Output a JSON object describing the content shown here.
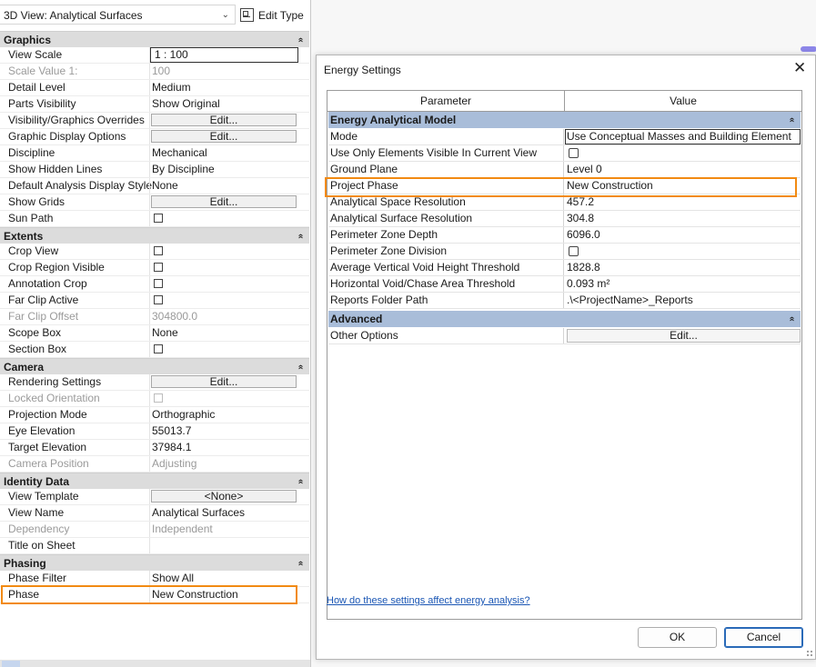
{
  "properties": {
    "type_selector": "3D View: Analytical Surfaces",
    "edit_type_label": "Edit Type",
    "sections": [
      {
        "title": "Graphics",
        "rows": [
          {
            "label": "View Scale",
            "value": "1 : 100",
            "kind": "input"
          },
          {
            "label": "Scale Value    1:",
            "value": "100",
            "kind": "text",
            "disabled": true
          },
          {
            "label": "Detail Level",
            "value": "Medium",
            "kind": "text"
          },
          {
            "label": "Parts Visibility",
            "value": "Show Original",
            "kind": "text"
          },
          {
            "label": "Visibility/Graphics Overrides",
            "value": "Edit...",
            "kind": "button"
          },
          {
            "label": "Graphic Display Options",
            "value": "Edit...",
            "kind": "button"
          },
          {
            "label": "Discipline",
            "value": "Mechanical",
            "kind": "text"
          },
          {
            "label": "Show Hidden Lines",
            "value": "By Discipline",
            "kind": "text"
          },
          {
            "label": "Default Analysis Display Style",
            "value": "None",
            "kind": "text"
          },
          {
            "label": "Show Grids",
            "value": "Edit...",
            "kind": "button"
          },
          {
            "label": "Sun Path",
            "value": "",
            "kind": "checkbox"
          }
        ]
      },
      {
        "title": "Extents",
        "rows": [
          {
            "label": "Crop View",
            "value": "",
            "kind": "checkbox"
          },
          {
            "label": "Crop Region Visible",
            "value": "",
            "kind": "checkbox"
          },
          {
            "label": "Annotation Crop",
            "value": "",
            "kind": "checkbox"
          },
          {
            "label": "Far Clip Active",
            "value": "",
            "kind": "checkbox"
          },
          {
            "label": "Far Clip Offset",
            "value": "304800.0",
            "kind": "text",
            "disabled": true
          },
          {
            "label": "Scope Box",
            "value": "None",
            "kind": "text"
          },
          {
            "label": "Section Box",
            "value": "",
            "kind": "checkbox"
          }
        ]
      },
      {
        "title": "Camera",
        "rows": [
          {
            "label": "Rendering Settings",
            "value": "Edit...",
            "kind": "button"
          },
          {
            "label": "Locked Orientation",
            "value": "",
            "kind": "checkbox",
            "disabled": true
          },
          {
            "label": "Projection Mode",
            "value": "Orthographic",
            "kind": "text"
          },
          {
            "label": "Eye Elevation",
            "value": "55013.7",
            "kind": "text"
          },
          {
            "label": "Target Elevation",
            "value": "37984.1",
            "kind": "text"
          },
          {
            "label": "Camera Position",
            "value": "Adjusting",
            "kind": "text",
            "disabled": true
          }
        ]
      },
      {
        "title": "Identity Data",
        "rows": [
          {
            "label": "View Template",
            "value": "<None>",
            "kind": "button"
          },
          {
            "label": "View Name",
            "value": "Analytical Surfaces",
            "kind": "text"
          },
          {
            "label": "Dependency",
            "value": "Independent",
            "kind": "text",
            "disabled": true
          },
          {
            "label": "Title on Sheet",
            "value": "",
            "kind": "text"
          }
        ]
      },
      {
        "title": "Phasing",
        "rows": [
          {
            "label": "Phase Filter",
            "value": "Show All",
            "kind": "text"
          },
          {
            "label": "Phase",
            "value": "New Construction",
            "kind": "text"
          }
        ]
      }
    ]
  },
  "dialog": {
    "title": "Energy Settings",
    "close_glyph": "✕",
    "columns": {
      "parameter": "Parameter",
      "value": "Value"
    },
    "sections": [
      {
        "title": "Energy Analytical Model",
        "rows": [
          {
            "label": "Mode",
            "value": "Use Conceptual Masses and Building Element",
            "kind": "dropdown"
          },
          {
            "label": "Use Only Elements Visible In Current View",
            "value": "",
            "kind": "checkbox"
          },
          {
            "label": "Ground Plane",
            "value": "Level 0",
            "kind": "text"
          },
          {
            "label": "Project Phase",
            "value": "New Construction",
            "kind": "text"
          },
          {
            "label": "Analytical Space Resolution",
            "value": "457.2",
            "kind": "text"
          },
          {
            "label": "Analytical Surface Resolution",
            "value": "304.8",
            "kind": "text"
          },
          {
            "label": "Perimeter Zone Depth",
            "value": "6096.0",
            "kind": "text"
          },
          {
            "label": "Perimeter Zone Division",
            "value": "",
            "kind": "checkbox"
          },
          {
            "label": "Average Vertical Void Height Threshold",
            "value": "1828.8",
            "kind": "text"
          },
          {
            "label": "Horizontal Void/Chase Area Threshold",
            "value": "0.093 m²",
            "kind": "text"
          },
          {
            "label": "Reports Folder Path",
            "value": ".\\<ProjectName>_Reports",
            "kind": "text"
          }
        ]
      },
      {
        "title": "Advanced",
        "rows": [
          {
            "label": "Other Options",
            "value": "Edit...",
            "kind": "button"
          }
        ]
      }
    ],
    "help_link": "How do these settings affect energy analysis?",
    "ok_label": "OK",
    "cancel_label": "Cancel"
  },
  "colors": {
    "highlight": "#f28a12",
    "dialog_section": "#a9bdd9",
    "palette_section": "#dcdcdc",
    "link": "#1a56b4"
  }
}
